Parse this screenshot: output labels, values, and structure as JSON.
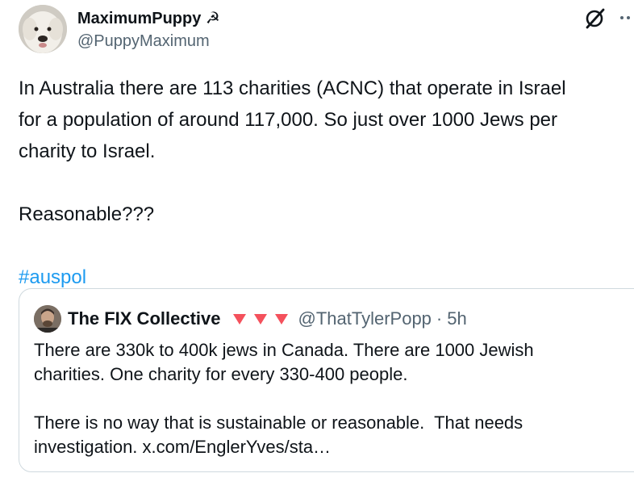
{
  "post": {
    "author_name": "MaximumPuppy",
    "author_badge": "☭",
    "author_handle": "@PuppyMaximum",
    "text": "In Australia there are 113 charities (ACNC) that operate in Israel\nfor a population of around 117,000. So just over 1000 Jews per\ncharity to Israel.\n\nReasonable???\n\n",
    "hashtag": "#auspol"
  },
  "quote": {
    "author_name": "The FIX Collective",
    "author_handle": "@ThatTylerPopp",
    "separator": "·",
    "time": "5h",
    "flag_color": "#f4515c",
    "text": "There are 330k to 400k jews in Canada. There are 1000 Jewish\ncharities. One charity for every 330-400 people.\n\nThere is no way that is sustainable or reasonable.  That needs\ninvestigation. x.com/EnglerYves/sta…"
  },
  "icons": {
    "grok": "grok-icon",
    "more": "more-icon"
  }
}
